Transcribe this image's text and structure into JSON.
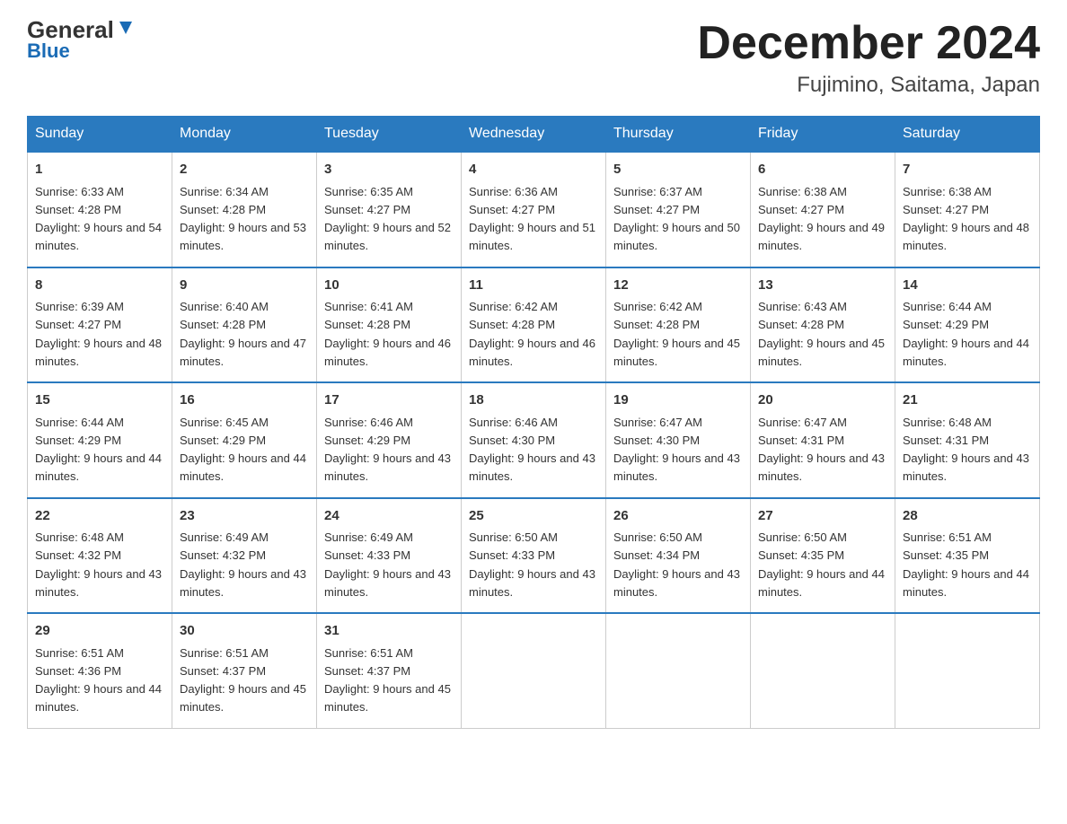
{
  "header": {
    "logo_general": "General",
    "logo_blue": "Blue",
    "title": "December 2024",
    "subtitle": "Fujimino, Saitama, Japan"
  },
  "calendar": {
    "days": [
      "Sunday",
      "Monday",
      "Tuesday",
      "Wednesday",
      "Thursday",
      "Friday",
      "Saturday"
    ],
    "weeks": [
      [
        {
          "num": "1",
          "sunrise": "6:33 AM",
          "sunset": "4:28 PM",
          "daylight": "9 hours and 54 minutes."
        },
        {
          "num": "2",
          "sunrise": "6:34 AM",
          "sunset": "4:28 PM",
          "daylight": "9 hours and 53 minutes."
        },
        {
          "num": "3",
          "sunrise": "6:35 AM",
          "sunset": "4:27 PM",
          "daylight": "9 hours and 52 minutes."
        },
        {
          "num": "4",
          "sunrise": "6:36 AM",
          "sunset": "4:27 PM",
          "daylight": "9 hours and 51 minutes."
        },
        {
          "num": "5",
          "sunrise": "6:37 AM",
          "sunset": "4:27 PM",
          "daylight": "9 hours and 50 minutes."
        },
        {
          "num": "6",
          "sunrise": "6:38 AM",
          "sunset": "4:27 PM",
          "daylight": "9 hours and 49 minutes."
        },
        {
          "num": "7",
          "sunrise": "6:38 AM",
          "sunset": "4:27 PM",
          "daylight": "9 hours and 48 minutes."
        }
      ],
      [
        {
          "num": "8",
          "sunrise": "6:39 AM",
          "sunset": "4:27 PM",
          "daylight": "9 hours and 48 minutes."
        },
        {
          "num": "9",
          "sunrise": "6:40 AM",
          "sunset": "4:28 PM",
          "daylight": "9 hours and 47 minutes."
        },
        {
          "num": "10",
          "sunrise": "6:41 AM",
          "sunset": "4:28 PM",
          "daylight": "9 hours and 46 minutes."
        },
        {
          "num": "11",
          "sunrise": "6:42 AM",
          "sunset": "4:28 PM",
          "daylight": "9 hours and 46 minutes."
        },
        {
          "num": "12",
          "sunrise": "6:42 AM",
          "sunset": "4:28 PM",
          "daylight": "9 hours and 45 minutes."
        },
        {
          "num": "13",
          "sunrise": "6:43 AM",
          "sunset": "4:28 PM",
          "daylight": "9 hours and 45 minutes."
        },
        {
          "num": "14",
          "sunrise": "6:44 AM",
          "sunset": "4:29 PM",
          "daylight": "9 hours and 44 minutes."
        }
      ],
      [
        {
          "num": "15",
          "sunrise": "6:44 AM",
          "sunset": "4:29 PM",
          "daylight": "9 hours and 44 minutes."
        },
        {
          "num": "16",
          "sunrise": "6:45 AM",
          "sunset": "4:29 PM",
          "daylight": "9 hours and 44 minutes."
        },
        {
          "num": "17",
          "sunrise": "6:46 AM",
          "sunset": "4:29 PM",
          "daylight": "9 hours and 43 minutes."
        },
        {
          "num": "18",
          "sunrise": "6:46 AM",
          "sunset": "4:30 PM",
          "daylight": "9 hours and 43 minutes."
        },
        {
          "num": "19",
          "sunrise": "6:47 AM",
          "sunset": "4:30 PM",
          "daylight": "9 hours and 43 minutes."
        },
        {
          "num": "20",
          "sunrise": "6:47 AM",
          "sunset": "4:31 PM",
          "daylight": "9 hours and 43 minutes."
        },
        {
          "num": "21",
          "sunrise": "6:48 AM",
          "sunset": "4:31 PM",
          "daylight": "9 hours and 43 minutes."
        }
      ],
      [
        {
          "num": "22",
          "sunrise": "6:48 AM",
          "sunset": "4:32 PM",
          "daylight": "9 hours and 43 minutes."
        },
        {
          "num": "23",
          "sunrise": "6:49 AM",
          "sunset": "4:32 PM",
          "daylight": "9 hours and 43 minutes."
        },
        {
          "num": "24",
          "sunrise": "6:49 AM",
          "sunset": "4:33 PM",
          "daylight": "9 hours and 43 minutes."
        },
        {
          "num": "25",
          "sunrise": "6:50 AM",
          "sunset": "4:33 PM",
          "daylight": "9 hours and 43 minutes."
        },
        {
          "num": "26",
          "sunrise": "6:50 AM",
          "sunset": "4:34 PM",
          "daylight": "9 hours and 43 minutes."
        },
        {
          "num": "27",
          "sunrise": "6:50 AM",
          "sunset": "4:35 PM",
          "daylight": "9 hours and 44 minutes."
        },
        {
          "num": "28",
          "sunrise": "6:51 AM",
          "sunset": "4:35 PM",
          "daylight": "9 hours and 44 minutes."
        }
      ],
      [
        {
          "num": "29",
          "sunrise": "6:51 AM",
          "sunset": "4:36 PM",
          "daylight": "9 hours and 44 minutes."
        },
        {
          "num": "30",
          "sunrise": "6:51 AM",
          "sunset": "4:37 PM",
          "daylight": "9 hours and 45 minutes."
        },
        {
          "num": "31",
          "sunrise": "6:51 AM",
          "sunset": "4:37 PM",
          "daylight": "9 hours and 45 minutes."
        },
        null,
        null,
        null,
        null
      ]
    ]
  }
}
